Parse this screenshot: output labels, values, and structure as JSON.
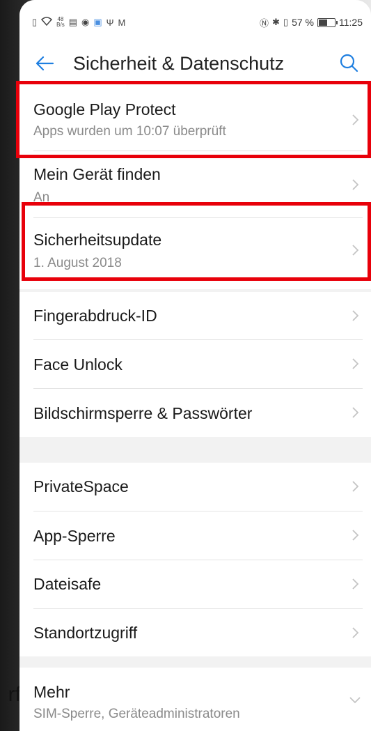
{
  "status_bar": {
    "net_speed_value": "48",
    "net_speed_unit": "B/s",
    "battery_text": "57 %",
    "time": "11:25"
  },
  "app_bar": {
    "title": "Sicherheit & Datenschutz",
    "back_icon": "arrow-left-icon",
    "search_icon": "search-icon"
  },
  "backdrop_text": "rf",
  "groups": [
    {
      "items": [
        {
          "title": "Google Play Protect",
          "subtitle": "Apps wurden um 10:07 überprüft",
          "highlighted": true
        },
        {
          "title": "Mein Gerät finden",
          "subtitle": "An",
          "highlighted": false
        },
        {
          "title": "Sicherheitsupdate",
          "subtitle": "1. August 2018",
          "highlighted": true
        }
      ]
    },
    {
      "items": [
        {
          "title": "Fingerabdruck-ID"
        },
        {
          "title": "Face Unlock"
        },
        {
          "title": "Bildschirmsperre & Passwörter"
        }
      ]
    },
    {
      "items": [
        {
          "title": "PrivateSpace"
        },
        {
          "title": "App-Sperre"
        },
        {
          "title": "Dateisafe"
        },
        {
          "title": "Standortzugriff"
        }
      ]
    },
    {
      "items": [
        {
          "title": "Mehr",
          "subtitle": "SIM-Sperre, Geräteadministratoren",
          "expand": true
        }
      ]
    }
  ],
  "colors": {
    "accent": "#1f7fe0",
    "highlight": "#e8000a",
    "background": "#f2f2f2"
  }
}
